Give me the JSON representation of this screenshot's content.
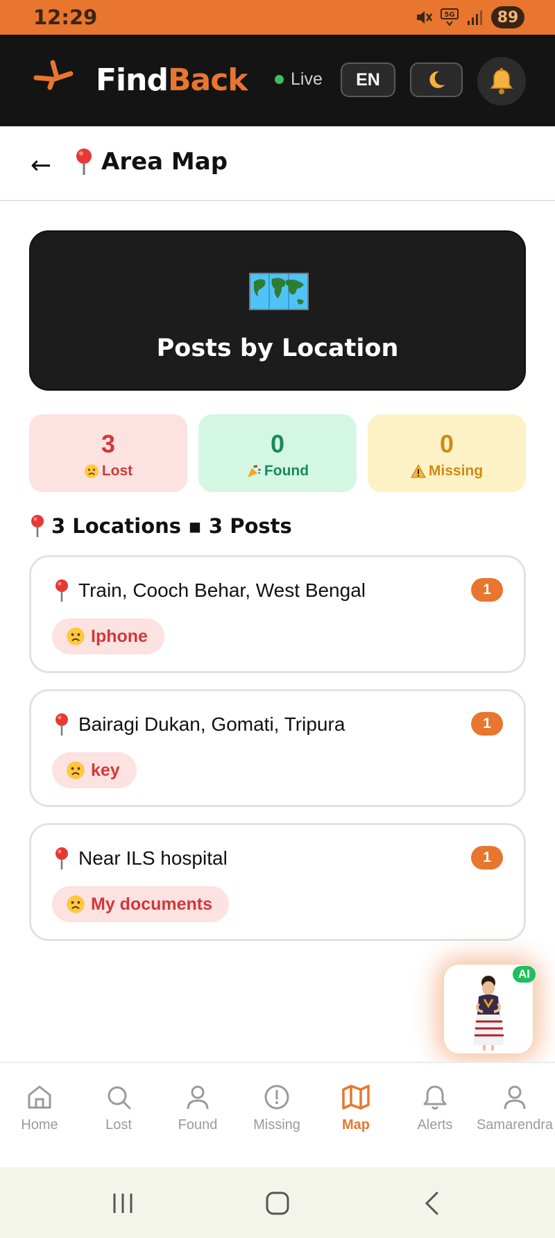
{
  "status": {
    "time": "12:29",
    "battery": "89",
    "network": "5G"
  },
  "header": {
    "brand_find": "Find",
    "brand_back": "Back",
    "live_label": "Live",
    "lang_label": "EN",
    "theme_icon": "moon-icon",
    "notif_icon": "bell-icon"
  },
  "page": {
    "title": "Area Map",
    "back_icon": "back-arrow-icon"
  },
  "hero": {
    "title": "Posts by Location",
    "icon": "world-map-icon"
  },
  "stats": [
    {
      "value": "3",
      "label": "Lost",
      "color": "#d13838"
    },
    {
      "value": "0",
      "label": "Found",
      "color": "#178a57"
    },
    {
      "value": "0",
      "label": "Missing",
      "color": "#d08a12"
    }
  ],
  "summary": "3 Locations ▪ 3 Posts",
  "locations": [
    {
      "name": "Train, Cooch Behar, West Bengal",
      "count": "1",
      "post": "Iphone"
    },
    {
      "name": "Bairagi Dukan, Gomati, Tripura",
      "count": "1",
      "post": "key"
    },
    {
      "name": "Near ILS hospital",
      "count": "1",
      "post": "My documents"
    }
  ],
  "ai": {
    "badge": "AI"
  },
  "nav": [
    {
      "label": "Home",
      "icon": "home-icon"
    },
    {
      "label": "Lost",
      "icon": "search-icon"
    },
    {
      "label": "Found",
      "icon": "user-icon"
    },
    {
      "label": "Missing",
      "icon": "alert-icon"
    },
    {
      "label": "Map",
      "icon": "map-icon",
      "active": true
    },
    {
      "label": "Alerts",
      "icon": "bell-icon"
    },
    {
      "label": "Samarendra",
      "icon": "profile-icon"
    }
  ],
  "colors": {
    "accent": "#E8762F",
    "header_bg": "#141414"
  }
}
